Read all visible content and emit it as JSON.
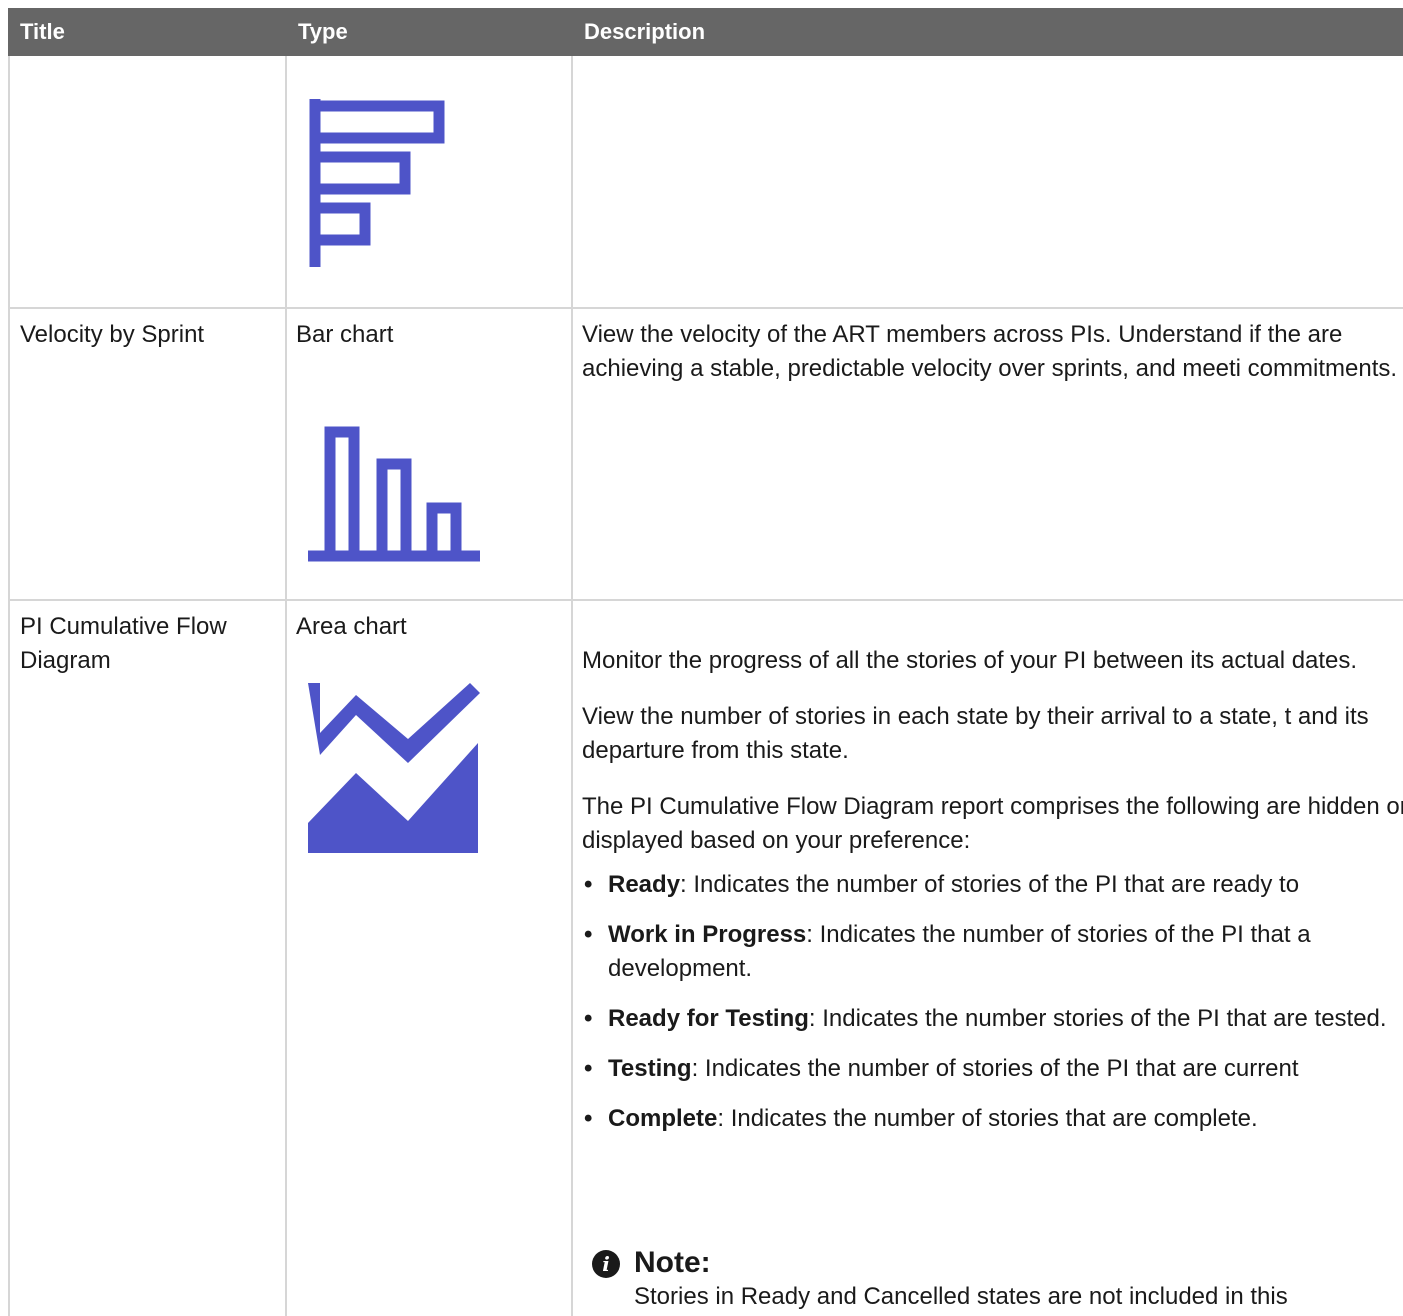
{
  "headers": {
    "title": "Title",
    "type": "Type",
    "description": "Description"
  },
  "rows": [
    {
      "title": "",
      "type": "",
      "icon": "horizontal-bar-chart-icon"
    },
    {
      "title": "Velocity by Sprint",
      "type": "Bar chart",
      "icon": "bar-chart-icon",
      "description": "View the velocity of the ART members across PIs. Understand if the are achieving a stable, predictable velocity over sprints, and meeti commitments."
    },
    {
      "title": "PI Cumulative Flow Diagram",
      "type": "Area chart",
      "icon": "area-chart-icon",
      "paragraphs": [
        "Monitor the progress of all the stories of your PI between its actual dates.",
        "View the number of stories in each state by their arrival to a state, t and its departure from this state.",
        "The PI Cumulative Flow Diagram report comprises the following are hidden or displayed based on your preference:"
      ],
      "bullets": [
        {
          "term": "Ready",
          "text": ": Indicates the number of stories of the PI that are ready to"
        },
        {
          "term": "Work in Progress",
          "text": ": Indicates the number of stories of the PI that a development."
        },
        {
          "term": "Ready for Testing",
          "text": ": Indicates the number stories of the PI that are tested."
        },
        {
          "term": "Testing",
          "text": ": Indicates the number of stories of the PI that are current"
        },
        {
          "term": "Complete",
          "text": ": Indicates the number of stories that are complete."
        }
      ],
      "note": {
        "title": "Note:",
        "text": "Stories in Ready and Cancelled states are not included in this"
      }
    }
  ],
  "colors": {
    "header_bg": "#666666",
    "icon": "#4e54c8",
    "grid": "#d6d6d6"
  }
}
